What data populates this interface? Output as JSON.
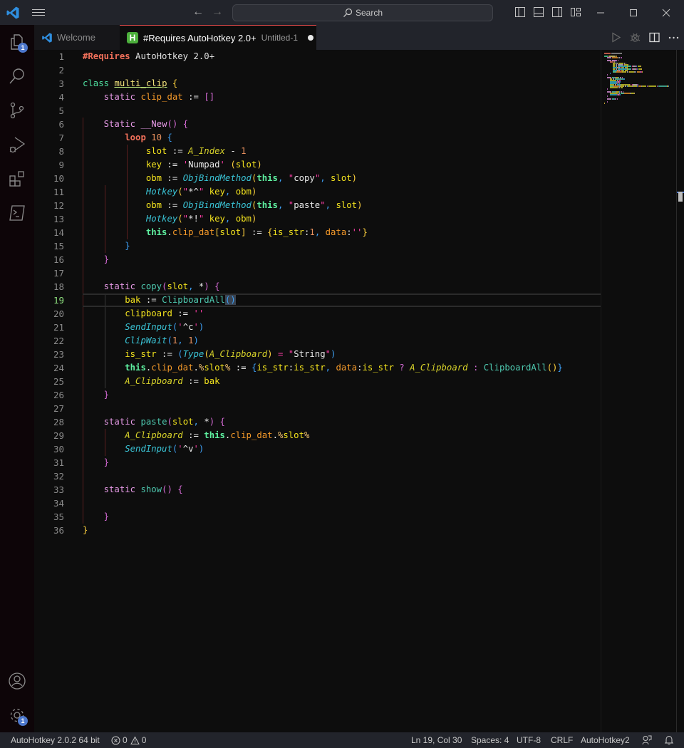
{
  "titlebar": {
    "search_placeholder": "Search"
  },
  "activity_bar": {
    "items": [
      {
        "name": "explorer",
        "badge": "1"
      },
      {
        "name": "search"
      },
      {
        "name": "source-control"
      },
      {
        "name": "run-and-debug"
      },
      {
        "name": "extensions"
      },
      {
        "name": "terminal"
      }
    ],
    "bottom": [
      {
        "name": "accounts"
      },
      {
        "name": "manage",
        "badge": "1"
      }
    ]
  },
  "tabs": [
    {
      "label": "Welcome",
      "active": false
    },
    {
      "label": "#Requires AutoHotkey 2.0+",
      "description": "Untitled-1",
      "active": true,
      "dirty": true
    }
  ],
  "editor": {
    "current_line": 19,
    "line_numbers": [
      "1",
      "2",
      "3",
      "4",
      "5",
      "6",
      "7",
      "8",
      "9",
      "10",
      "11",
      "12",
      "13",
      "14",
      "15",
      "16",
      "17",
      "18",
      "19",
      "20",
      "21",
      "22",
      "23",
      "24",
      "25",
      "26",
      "27",
      "28",
      "29",
      "30",
      "31",
      "32",
      "33",
      "34",
      "35",
      "36"
    ],
    "lines": [
      [
        [
          "k-dir",
          "#Requires"
        ],
        [
          "k-pl",
          " AutoHotkey 2.0+"
        ]
      ],
      [],
      [
        [
          "k-kw",
          "class"
        ],
        [
          "k-pl",
          " "
        ],
        [
          "k-cls",
          "multi_clip"
        ],
        [
          "k-pl",
          " "
        ],
        [
          "k-br1",
          "{"
        ]
      ],
      [
        [
          "k-pl",
          "    "
        ],
        [
          "k-static",
          "static"
        ],
        [
          "k-pl",
          " "
        ],
        [
          "k-prop",
          "clip_dat"
        ],
        [
          "k-op",
          " := "
        ],
        [
          "k-br2",
          "[]"
        ]
      ],
      [],
      [
        [
          "k-pl",
          "    "
        ],
        [
          "k-static",
          "Static"
        ],
        [
          "k-pl",
          " "
        ],
        [
          "k-static",
          "__New"
        ],
        [
          "k-br2",
          "()"
        ],
        [
          "k-pl",
          " "
        ],
        [
          "k-br2",
          "{"
        ]
      ],
      [
        [
          "k-pl",
          "        "
        ],
        [
          "k-loop",
          "loop"
        ],
        [
          "k-pl",
          " "
        ],
        [
          "k-num",
          "10"
        ],
        [
          "k-pl",
          " "
        ],
        [
          "k-br3",
          "{"
        ]
      ],
      [
        [
          "k-pl",
          "            "
        ],
        [
          "k-var",
          "slot"
        ],
        [
          "k-op",
          " := "
        ],
        [
          "k-bvar",
          "A_Index"
        ],
        [
          "k-op",
          " - "
        ],
        [
          "k-num",
          "1"
        ]
      ],
      [
        [
          "k-pl",
          "            "
        ],
        [
          "k-var",
          "key"
        ],
        [
          "k-op",
          " := "
        ],
        [
          "k-q",
          "'"
        ],
        [
          "k-str",
          "Numpad"
        ],
        [
          "k-q",
          "'"
        ],
        [
          "k-pl",
          " "
        ],
        [
          "k-br1",
          "("
        ],
        [
          "k-var",
          "slot"
        ],
        [
          "k-br1",
          ")"
        ]
      ],
      [
        [
          "k-pl",
          "            "
        ],
        [
          "k-var",
          "obm"
        ],
        [
          "k-op",
          " := "
        ],
        [
          "k-fni",
          "ObjBindMethod"
        ],
        [
          "k-br1",
          "("
        ],
        [
          "k-this",
          "this"
        ],
        [
          "k-br3",
          ","
        ],
        [
          "k-pl",
          " "
        ],
        [
          "k-q",
          "\""
        ],
        [
          "k-str",
          "copy"
        ],
        [
          "k-q",
          "\""
        ],
        [
          "k-br3",
          ","
        ],
        [
          "k-pl",
          " "
        ],
        [
          "k-var",
          "slot"
        ],
        [
          "k-br1",
          ")"
        ]
      ],
      [
        [
          "k-pl",
          "            "
        ],
        [
          "k-fni",
          "Hotkey"
        ],
        [
          "k-br1",
          "("
        ],
        [
          "k-q",
          "\""
        ],
        [
          "k-str",
          "*^"
        ],
        [
          "k-q",
          "\""
        ],
        [
          "k-pl",
          " "
        ],
        [
          "k-var",
          "key"
        ],
        [
          "k-br3",
          ","
        ],
        [
          "k-pl",
          " "
        ],
        [
          "k-var",
          "obm"
        ],
        [
          "k-br1",
          ")"
        ]
      ],
      [
        [
          "k-pl",
          "            "
        ],
        [
          "k-var",
          "obm"
        ],
        [
          "k-op",
          " := "
        ],
        [
          "k-fni",
          "ObjBindMethod"
        ],
        [
          "k-br1",
          "("
        ],
        [
          "k-this",
          "this"
        ],
        [
          "k-br3",
          ","
        ],
        [
          "k-pl",
          " "
        ],
        [
          "k-q",
          "\""
        ],
        [
          "k-str",
          "paste"
        ],
        [
          "k-q",
          "\""
        ],
        [
          "k-br3",
          ","
        ],
        [
          "k-pl",
          " "
        ],
        [
          "k-var",
          "slot"
        ],
        [
          "k-br1",
          ")"
        ]
      ],
      [
        [
          "k-pl",
          "            "
        ],
        [
          "k-fni",
          "Hotkey"
        ],
        [
          "k-br1",
          "("
        ],
        [
          "k-q",
          "\""
        ],
        [
          "k-str",
          "*!"
        ],
        [
          "k-q",
          "\""
        ],
        [
          "k-pl",
          " "
        ],
        [
          "k-var",
          "key"
        ],
        [
          "k-br3",
          ","
        ],
        [
          "k-pl",
          " "
        ],
        [
          "k-var",
          "obm"
        ],
        [
          "k-br1",
          ")"
        ]
      ],
      [
        [
          "k-pl",
          "            "
        ],
        [
          "k-this",
          "this"
        ],
        [
          "k-op",
          "."
        ],
        [
          "k-prop",
          "clip_dat"
        ],
        [
          "k-br1",
          "["
        ],
        [
          "k-var",
          "slot"
        ],
        [
          "k-br1",
          "]"
        ],
        [
          "k-op",
          " := "
        ],
        [
          "k-br1",
          "{"
        ],
        [
          "k-var",
          "is_str"
        ],
        [
          "k-op",
          ":"
        ],
        [
          "k-num",
          "1"
        ],
        [
          "k-br3",
          ","
        ],
        [
          "k-pl",
          " "
        ],
        [
          "k-prop",
          "data"
        ],
        [
          "k-op",
          ":"
        ],
        [
          "k-q",
          "''"
        ],
        [
          "k-br1",
          "}"
        ]
      ],
      [
        [
          "k-pl",
          "        "
        ],
        [
          "k-br3",
          "}"
        ]
      ],
      [
        [
          "k-pl",
          "    "
        ],
        [
          "k-br2",
          "}"
        ]
      ],
      [],
      [
        [
          "k-pl",
          "    "
        ],
        [
          "k-static",
          "static"
        ],
        [
          "k-pl",
          " "
        ],
        [
          "k-fn",
          "copy"
        ],
        [
          "k-br2",
          "("
        ],
        [
          "k-var",
          "slot"
        ],
        [
          "k-br3",
          ","
        ],
        [
          "k-pl",
          " "
        ],
        [
          "k-op",
          "*"
        ],
        [
          "k-br2",
          ")"
        ],
        [
          "k-pl",
          " "
        ],
        [
          "k-br2",
          "{"
        ]
      ],
      [
        [
          "k-pl",
          "        "
        ],
        [
          "k-var",
          "bak"
        ],
        [
          "k-op",
          " := "
        ],
        [
          "k-fn",
          "ClipboardAll"
        ],
        [
          "k-br3 k-cursorbr",
          "()"
        ]
      ],
      [
        [
          "k-pl",
          "        "
        ],
        [
          "k-var",
          "clipboard"
        ],
        [
          "k-op",
          " := "
        ],
        [
          "k-q",
          "''"
        ]
      ],
      [
        [
          "k-pl",
          "        "
        ],
        [
          "k-fni",
          "SendInput"
        ],
        [
          "k-br3",
          "("
        ],
        [
          "k-q",
          "'"
        ],
        [
          "k-str",
          "^c"
        ],
        [
          "k-q",
          "'"
        ],
        [
          "k-br3",
          ")"
        ]
      ],
      [
        [
          "k-pl",
          "        "
        ],
        [
          "k-fni",
          "ClipWait"
        ],
        [
          "k-br3",
          "("
        ],
        [
          "k-num",
          "1"
        ],
        [
          "k-br3",
          ","
        ],
        [
          "k-pl",
          " "
        ],
        [
          "k-num",
          "1"
        ],
        [
          "k-br3",
          ")"
        ]
      ],
      [
        [
          "k-pl",
          "        "
        ],
        [
          "k-var",
          "is_str"
        ],
        [
          "k-op",
          " := "
        ],
        [
          "k-br3",
          "("
        ],
        [
          "k-fni",
          "Type"
        ],
        [
          "k-br1",
          "("
        ],
        [
          "k-bvar",
          "A_Clipboard"
        ],
        [
          "k-br1",
          ")"
        ],
        [
          "k-pl",
          " "
        ],
        [
          "k-q",
          "="
        ],
        [
          "k-pl",
          " "
        ],
        [
          "k-q",
          "\""
        ],
        [
          "k-str",
          "String"
        ],
        [
          "k-q",
          "\""
        ],
        [
          "k-br3",
          ")"
        ]
      ],
      [
        [
          "k-pl",
          "        "
        ],
        [
          "k-this",
          "this"
        ],
        [
          "k-op",
          "."
        ],
        [
          "k-prop",
          "clip_dat"
        ],
        [
          "k-op",
          "."
        ],
        [
          "k-pct",
          "%"
        ],
        [
          "k-var",
          "slot"
        ],
        [
          "k-pct",
          "%"
        ],
        [
          "k-op",
          " := "
        ],
        [
          "k-br3",
          "{"
        ],
        [
          "k-var",
          "is_str"
        ],
        [
          "k-op",
          ":"
        ],
        [
          "k-var",
          "is_str"
        ],
        [
          "k-br3",
          ","
        ],
        [
          "k-pl",
          " "
        ],
        [
          "k-prop",
          "data"
        ],
        [
          "k-op",
          ":"
        ],
        [
          "k-var",
          "is_str"
        ],
        [
          "k-pl",
          " "
        ],
        [
          "k-br2",
          "?"
        ],
        [
          "k-pl",
          " "
        ],
        [
          "k-bvar",
          "A_Clipboard"
        ],
        [
          "k-pl",
          " "
        ],
        [
          "k-br2",
          ":"
        ],
        [
          "k-pl",
          " "
        ],
        [
          "k-fn",
          "ClipboardAll"
        ],
        [
          "k-br1",
          "()"
        ],
        [
          "k-br3",
          "}"
        ]
      ],
      [
        [
          "k-pl",
          "        "
        ],
        [
          "k-bvar",
          "A_Clipboard"
        ],
        [
          "k-op",
          " := "
        ],
        [
          "k-var",
          "bak"
        ]
      ],
      [
        [
          "k-pl",
          "    "
        ],
        [
          "k-br2",
          "}"
        ]
      ],
      [],
      [
        [
          "k-pl",
          "    "
        ],
        [
          "k-static",
          "static"
        ],
        [
          "k-pl",
          " "
        ],
        [
          "k-fn",
          "paste"
        ],
        [
          "k-br2",
          "("
        ],
        [
          "k-var",
          "slot"
        ],
        [
          "k-br3",
          ","
        ],
        [
          "k-pl",
          " "
        ],
        [
          "k-op",
          "*"
        ],
        [
          "k-br2",
          ")"
        ],
        [
          "k-pl",
          " "
        ],
        [
          "k-br2",
          "{"
        ]
      ],
      [
        [
          "k-pl",
          "        "
        ],
        [
          "k-bvar",
          "A_Clipboard"
        ],
        [
          "k-op",
          " := "
        ],
        [
          "k-this",
          "this"
        ],
        [
          "k-op",
          "."
        ],
        [
          "k-prop",
          "clip_dat"
        ],
        [
          "k-op",
          "."
        ],
        [
          "k-pct",
          "%"
        ],
        [
          "k-var",
          "slot"
        ],
        [
          "k-pct",
          "%"
        ]
      ],
      [
        [
          "k-pl",
          "        "
        ],
        [
          "k-fni",
          "SendInput"
        ],
        [
          "k-br3",
          "("
        ],
        [
          "k-q",
          "'"
        ],
        [
          "k-str",
          "^v"
        ],
        [
          "k-q",
          "'"
        ],
        [
          "k-br3",
          ")"
        ]
      ],
      [
        [
          "k-pl",
          "    "
        ],
        [
          "k-br2",
          "}"
        ]
      ],
      [],
      [
        [
          "k-pl",
          "    "
        ],
        [
          "k-static",
          "static"
        ],
        [
          "k-pl",
          " "
        ],
        [
          "k-fn",
          "show"
        ],
        [
          "k-br2",
          "()"
        ],
        [
          "k-pl",
          " "
        ],
        [
          "k-br2",
          "{"
        ]
      ],
      [],
      [
        [
          "k-pl",
          "    "
        ],
        [
          "k-br2",
          "}"
        ]
      ],
      [
        [
          "k-br1",
          "}"
        ]
      ]
    ]
  },
  "statusbar": {
    "interpreter": "AutoHotkey 2.0.2 64 bit",
    "errors": "0",
    "warnings": "0",
    "cursor_position": "Ln 19, Col 30",
    "indentation": "Spaces: 4",
    "encoding": "UTF-8",
    "line_endings": "CRLF",
    "language_mode": "AutoHotkey2"
  }
}
